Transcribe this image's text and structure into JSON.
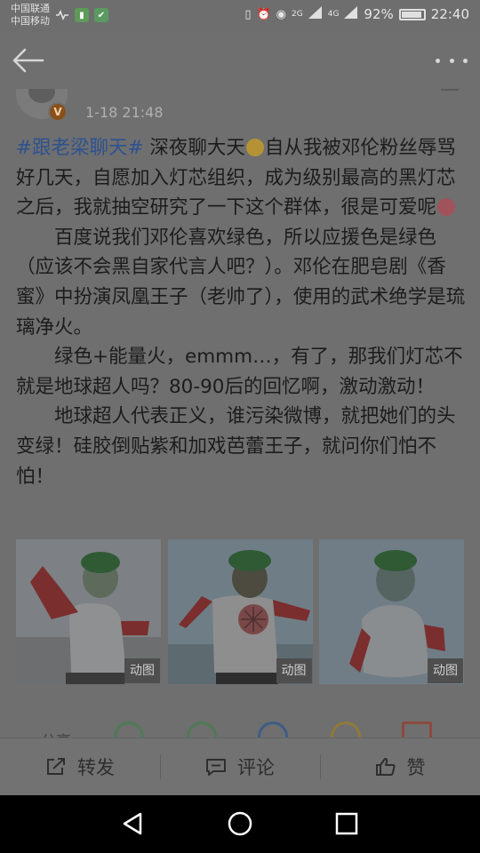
{
  "status_bar": {
    "carrier_1": "中国联通",
    "carrier_2": "中国移动",
    "net_1": "2G",
    "net_2": "4G",
    "battery_text": "92%",
    "battery_level": 0.92,
    "time": "22:40"
  },
  "post": {
    "author_badge": "V",
    "time": "1-18 21:48",
    "hashtag": "#跟老梁聊天#",
    "line1_a": "深夜聊大天",
    "line1_b": "自从我被邓伦粉丝辱骂好几天，自愿加入灯芯组织，成为级别最高的黑灯芯之后，我就抽空研究了一下这个群体，很是可爱呢",
    "para2": "百度说我们邓伦喜欢绿色，所以应援色是绿色（应该不会黑自家代言人吧？）。邓伦在肥皂剧《香蜜》中扮演凤凰王子（老帅了），使用的武术绝学是琉璃净火。",
    "para3": "绿色+能量火，emmm…，有了，那我们灯芯不就是地球超人吗？80-90后的回忆啊，激动激动！",
    "para4": "地球超人代表正义，谁污染微博，就把她们的头变绿！硅胶倒贴紫和加戏芭蕾王子，就问你们怕不怕！",
    "images": [
      {
        "tag": "动图"
      },
      {
        "tag": "动图"
      },
      {
        "tag": "动图"
      }
    ]
  },
  "share": {
    "label": "分享"
  },
  "actions": {
    "repost": "转发",
    "comment": "评论",
    "like": "赞"
  }
}
